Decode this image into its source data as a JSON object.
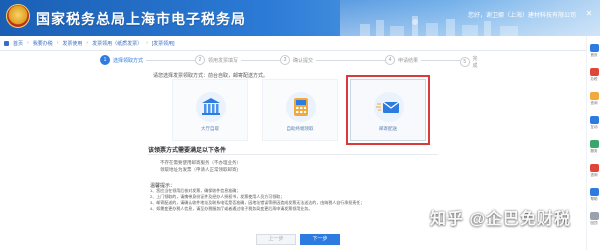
{
  "header": {
    "title": "国家税务总局上海市电子税务局",
    "user_info": [
      "您好，谢卫娜（上海）建材科技有限公司"
    ],
    "close_icon": "close-icon"
  },
  "breadcrumb": [
    "首页",
    "我要办税",
    "发票使用",
    "发票领用（纸质发票）",
    "[发票领用]"
  ],
  "steps": [
    {
      "num": "1",
      "label": "选择领取方式",
      "active": true
    },
    {
      "num": "2",
      "label": "领用发票填写",
      "active": false
    },
    {
      "num": "3",
      "label": "确认提交",
      "active": false
    },
    {
      "num": "4",
      "label": "申请结果",
      "active": false
    },
    {
      "num": "5",
      "label": "完成",
      "active": false
    }
  ],
  "hint": "请您选择发票领取方式：前台自取，邮寄配送方式。",
  "options": [
    {
      "label": "大厅自取",
      "icon": "bank-icon",
      "selected": false
    },
    {
      "label": "自助终端领取",
      "icon": "terminal-icon",
      "selected": false
    },
    {
      "label": "邮寄配送",
      "icon": "mail-icon",
      "selected": true
    }
  ],
  "section_title": "该领票方式需要满足以下条件",
  "requirements": [
    "不存在需要使用邮寄服务（不办理业务）",
    "领取地址为发票（申请人正常领取邮寄)"
  ],
  "notes_title": "温馨提示：",
  "notes": [
    "1、您应当在领用后核对发票，确保收件信息准确；",
    "2、上门领取的，请携带身份证件及经办人授权书，发票使用人员方可领取；",
    "3、邮寄配送的，请确认收件地址及联系电话是否准确，因地址错误等原因造成发票无法送达的，由纳税人自行承担责任；",
    "4、如需变更办税人信息，请至办税服务厅或者通过电子税务局变更后再申请发票领用业务。"
  ],
  "buttons": {
    "prev": "上一步",
    "next": "下一步"
  },
  "watermark": "知乎 @企巴免财税",
  "right_bar": [
    "首页",
    "办税",
    "查询",
    "互动",
    "服务",
    "咨询",
    "帮助",
    "回顶"
  ],
  "colors": {
    "accent": "#2d7be0",
    "selection": "#d93a3a",
    "header": "#1a5fb4"
  }
}
